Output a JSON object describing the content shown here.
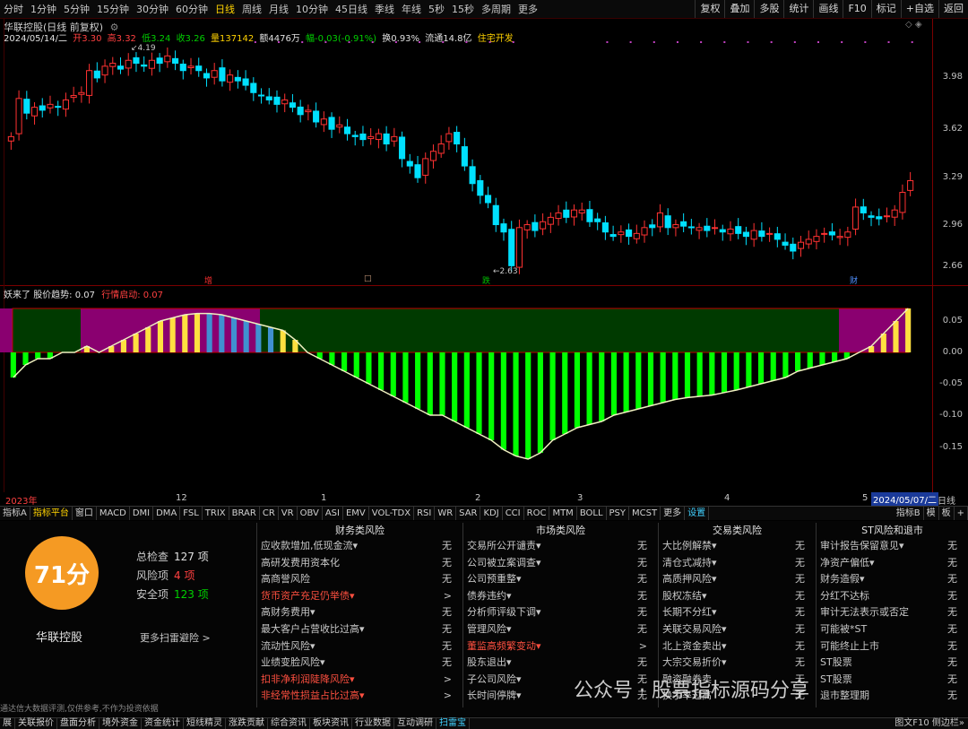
{
  "toolbar": {
    "periods": [
      "分时",
      "1分钟",
      "5分钟",
      "15分钟",
      "30分钟",
      "60分钟",
      "日线",
      "周线",
      "月线",
      "10分钟",
      "45日线",
      "季线",
      "年线",
      "5秒",
      "15秒",
      "多周期",
      "更多"
    ],
    "active_period": "日线",
    "right_buttons": [
      "复权",
      "叠加",
      "多股",
      "统计",
      "画线",
      "F10",
      "标记",
      "+自选",
      "返回"
    ]
  },
  "title": "华联控股(日线 前复权)",
  "quote": {
    "date": "2024/05/14/二",
    "open": "开3.30",
    "high": "高3.32",
    "low": "低3.24",
    "close": "收3.26",
    "vol": "量137142",
    "amt": "额4476万",
    "chg": "幅-0.03(-0.91%)",
    "turnover": "换0.93%",
    "float": "流通14.8亿",
    "concept": "住宅开发"
  },
  "price_axis": [
    "3.98",
    "3.62",
    "3.29",
    "2.96",
    "2.66"
  ],
  "price_annotations": {
    "high": "4.19",
    "low": "2.63"
  },
  "event_markers": [
    {
      "label": "增",
      "color": "#ff3030"
    },
    {
      "label": "□",
      "color": "#d0a080"
    },
    {
      "label": "跌",
      "color": "#00c000"
    },
    {
      "label": "财",
      "color": "#5090ff"
    }
  ],
  "indicator": {
    "name": "妖来了",
    "l1": "股价趋势:",
    "v1": "0.07",
    "l2": "行情启动:",
    "v2": "0.07"
  },
  "ind_axis": [
    "0.05",
    "0.00",
    "-0.05",
    "-0.10",
    "-0.15"
  ],
  "time_axis": {
    "t0": "2023年",
    "t1": "12",
    "t2": "1",
    "t3": "2",
    "t4": "3",
    "t5": "4",
    "t6": "5",
    "t7": "2024/05/07/二",
    "t8": "日线"
  },
  "tabs": [
    "指标A",
    "指标平台",
    "窗口",
    "MACD",
    "DMI",
    "DMA",
    "FSL",
    "TRIX",
    "BRAR",
    "CR",
    "VR",
    "OBV",
    "ASI",
    "EMV",
    "VOL-TDX",
    "RSI",
    "WR",
    "SAR",
    "KDJ",
    "CCI",
    "ROC",
    "MTM",
    "BOLL",
    "PSY",
    "MCST",
    "更多",
    "设置"
  ],
  "tabs_right": [
    "指标B",
    "模",
    "板",
    "+"
  ],
  "score": {
    "value": "71分",
    "name": "华联控股",
    "total_label": "总检查",
    "total": "127 项",
    "risk_label": "风险项",
    "risk": "4 项",
    "safe_label": "安全项",
    "safe": "123 项",
    "more": "更多扫雷避险 >"
  },
  "risk_columns": [
    {
      "title": "财务类风险",
      "rows": [
        {
          "t": "应收款增加,低现金流▾",
          "v": "无",
          "w": false
        },
        {
          "t": "高研发费用资本化",
          "v": "无",
          "w": false
        },
        {
          "t": "高商誉风险",
          "v": "无",
          "w": false
        },
        {
          "t": "货币资产充足仍举债▾",
          "v": ">",
          "w": true
        },
        {
          "t": "高财务费用▾",
          "v": "无",
          "w": false
        },
        {
          "t": "最大客户占营收比过高▾",
          "v": "无",
          "w": false
        },
        {
          "t": "流动性风险▾",
          "v": "无",
          "w": false
        },
        {
          "t": "业绩变脸风险▾",
          "v": "无",
          "w": false
        },
        {
          "t": "扣非净利润陡降风险▾",
          "v": ">",
          "w": true
        },
        {
          "t": "非经常性损益占比过高▾",
          "v": ">",
          "w": true
        }
      ]
    },
    {
      "title": "市场类风险",
      "rows": [
        {
          "t": "交易所公开谴责▾",
          "v": "无",
          "w": false
        },
        {
          "t": "公司被立案调查▾",
          "v": "无",
          "w": false
        },
        {
          "t": "公司预重整▾",
          "v": "无",
          "w": false
        },
        {
          "t": "债券违约▾",
          "v": "无",
          "w": false
        },
        {
          "t": "分析师评级下调▾",
          "v": "无",
          "w": false
        },
        {
          "t": "管理风险▾",
          "v": "无",
          "w": false
        },
        {
          "t": "董监高频繁变动▾",
          "v": ">",
          "w": true
        },
        {
          "t": "股东退出▾",
          "v": "无",
          "w": false
        },
        {
          "t": "子公司风险▾",
          "v": "无",
          "w": false
        },
        {
          "t": "长时间停牌▾",
          "v": "无",
          "w": false
        }
      ]
    },
    {
      "title": "交易类风险",
      "rows": [
        {
          "t": "大比例解禁▾",
          "v": "无",
          "w": false
        },
        {
          "t": "清仓式减持▾",
          "v": "无",
          "w": false
        },
        {
          "t": "高质押风险▾",
          "v": "无",
          "w": false
        },
        {
          "t": "股权冻结▾",
          "v": "无",
          "w": false
        },
        {
          "t": "长期不分红▾",
          "v": "无",
          "w": false
        },
        {
          "t": "关联交易风险▾",
          "v": "无",
          "w": false
        },
        {
          "t": "北上资金卖出▾",
          "v": "无",
          "w": false
        },
        {
          "t": "大宗交易折价▾",
          "v": "无",
          "w": false
        },
        {
          "t": "融资融券卖",
          "v": "无",
          "w": false
        },
        {
          "t": "换手率过高",
          "v": "无",
          "w": false
        }
      ]
    },
    {
      "title": "ST风险和退市",
      "rows": [
        {
          "t": "审计报告保留意见▾",
          "v": "无",
          "w": false
        },
        {
          "t": "净资产偏低▾",
          "v": "无",
          "w": false
        },
        {
          "t": "财务造假▾",
          "v": "无",
          "w": false
        },
        {
          "t": "分红不达标",
          "v": "无",
          "w": false
        },
        {
          "t": "审计无法表示或否定",
          "v": "无",
          "w": false
        },
        {
          "t": "可能被*ST",
          "v": "无",
          "w": false
        },
        {
          "t": "可能终止上市",
          "v": "无",
          "w": false
        },
        {
          "t": "ST股票",
          "v": "无",
          "w": false
        },
        {
          "t": "ST股票",
          "v": "无",
          "w": false
        },
        {
          "t": "退市整理期",
          "v": "无",
          "w": false
        }
      ]
    }
  ],
  "disclaimer": "通达信大数据评测,仅供参考,不作为投资依据",
  "watermark": "公众号 · 股票指标源码分享",
  "bottom": {
    "items": [
      "展",
      "关联报价",
      "盘面分析",
      "境外资金",
      "资金统计",
      "短线精灵",
      "涨跌贡献",
      "综合资讯",
      "板块资讯",
      "行业数据",
      "互动调研",
      "扫雷宝"
    ],
    "active": "扫雷宝",
    "right": "图文F10 侧边栏»"
  },
  "colors": {
    "up": "#ff3232",
    "down": "#00e0ff",
    "trend_green": "#00ff00",
    "panel_bg_green": "#003a00",
    "panel_bg_purple": "#8a0070",
    "bar_yellow": "#ffe040",
    "bar_blue": "#4090d0"
  },
  "chart_data": [
    {
      "type": "candlestick",
      "title": "华联控股(日线 前复权)",
      "ylim": [
        2.6,
        4.25
      ],
      "close": [
        3.6,
        3.86,
        3.76,
        3.8,
        3.78,
        3.82,
        3.8,
        3.85,
        3.88,
        3.9,
        4.05,
        4.0,
        4.08,
        4.1,
        4.06,
        4.12,
        4.1,
        4.08,
        4.12,
        4.1,
        4.15,
        4.1,
        4.05,
        4.08,
        4.05,
        4.0,
        4.05,
        3.98,
        4.02,
        3.98,
        3.95,
        3.9,
        3.88,
        3.85,
        3.82,
        3.85,
        3.8,
        3.75,
        3.78,
        3.7,
        3.72,
        3.65,
        3.68,
        3.62,
        3.6,
        3.58,
        3.6,
        3.62,
        3.55,
        3.6,
        3.45,
        3.4,
        3.32,
        3.45,
        3.5,
        3.55,
        3.62,
        3.55,
        3.4,
        3.28,
        3.2,
        3.15,
        3.0,
        2.95,
        2.72,
        2.98,
        3.0,
        2.96,
        3.02,
        3.05,
        3.08,
        3.05,
        3.1,
        3.1,
        3.02,
        3.02,
        2.95,
        2.92,
        2.95,
        2.92,
        2.94,
        2.98,
        2.98,
        3.08,
        2.98,
        3.0,
        2.99,
        2.98,
        2.98,
        2.96,
        2.98,
        2.95,
        2.97,
        2.94,
        2.92,
        2.96,
        2.92,
        2.94,
        2.9,
        2.86,
        2.82,
        2.88,
        2.9,
        2.92,
        2.94,
        2.93,
        2.92,
        2.95,
        3.12,
        3.08,
        3.05,
        3.04,
        3.06,
        3.1,
        3.22,
        3.3
      ]
    },
    {
      "type": "bar",
      "title": "妖来了",
      "series": [
        {
          "name": "股价趋势",
          "values": [
            -0.04,
            -0.02,
            -0.01,
            -0.01,
            0.0,
            0.0,
            0.01,
            0.0,
            0.01,
            0.02,
            0.03,
            0.04,
            0.05,
            0.055,
            0.06,
            0.062,
            0.062,
            0.06,
            0.055,
            0.05,
            0.045,
            0.04,
            0.035,
            0.02,
            0.0,
            -0.01,
            -0.02,
            -0.03,
            -0.04,
            -0.05,
            -0.06,
            -0.07,
            -0.08,
            -0.09,
            -0.1,
            -0.1,
            -0.11,
            -0.12,
            -0.13,
            -0.14,
            -0.155,
            -0.165,
            -0.17,
            -0.16,
            -0.14,
            -0.13,
            -0.12,
            -0.115,
            -0.11,
            -0.1,
            -0.095,
            -0.09,
            -0.085,
            -0.08,
            -0.075,
            -0.072,
            -0.07,
            -0.068,
            -0.064,
            -0.06,
            -0.055,
            -0.05,
            -0.045,
            -0.04,
            -0.03,
            -0.025,
            -0.02,
            -0.015,
            -0.01,
            0.0,
            0.01,
            0.03,
            0.05,
            0.07
          ]
        }
      ]
    }
  ]
}
